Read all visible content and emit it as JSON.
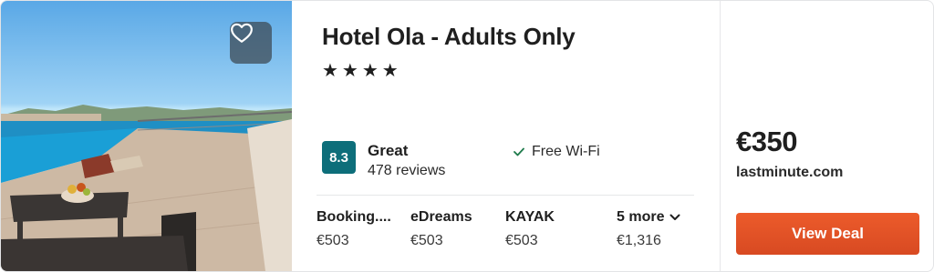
{
  "hotel": {
    "name": "Hotel Ola - Adults Only",
    "stars": "★★★★",
    "star_count": 4,
    "rating": {
      "score": "8.3",
      "label": "Great",
      "reviews": "478 reviews",
      "badge_color": "#0d6e7a"
    },
    "amenity": "Free Wi-Fi"
  },
  "providers": [
    {
      "name": "Booking....",
      "price": "€503"
    },
    {
      "name": "eDreams",
      "price": "€503"
    },
    {
      "name": "KAYAK",
      "price": "€503"
    },
    {
      "name": "5 more",
      "price": "€1,316"
    }
  ],
  "deal": {
    "price": "€350",
    "site": "lastminute.com",
    "button_label": "View Deal",
    "button_color": "#e2542a"
  },
  "icons": {
    "favorite": "heart-icon",
    "amenity": "check-icon",
    "more": "chevron-down-icon"
  }
}
